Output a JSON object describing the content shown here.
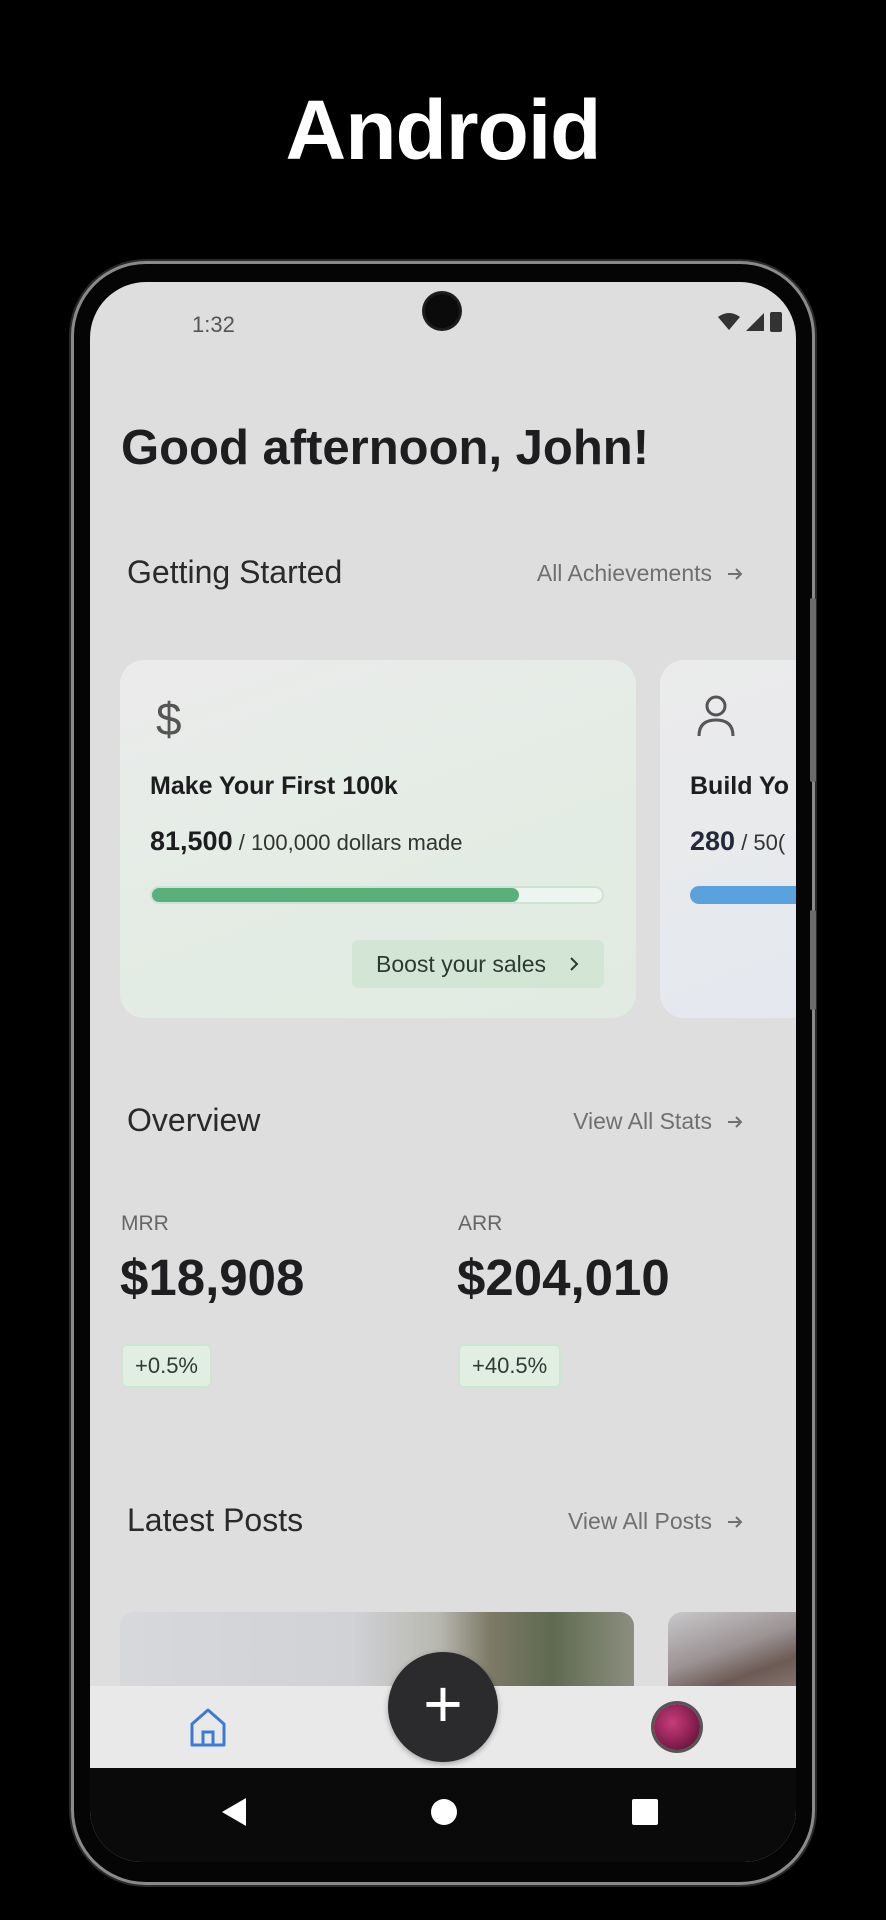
{
  "banner": {
    "title": "Android"
  },
  "status_bar": {
    "time": "1:32"
  },
  "home": {
    "greeting": "Good afternoon, John!"
  },
  "getting_started": {
    "title": "Getting Started",
    "link": "All Achievements",
    "cards": [
      {
        "icon": "dollar-icon",
        "icon_glyph": "$",
        "title": "Make Your First 100k",
        "current": "81,500",
        "suffix": "/ 100,000 dollars made",
        "progress": 0.815,
        "bar_color": "#5ab07a",
        "action": "Boost your sales"
      },
      {
        "icon": "user-icon",
        "title": "Build Yo",
        "current": "280",
        "suffix": "/ 50(",
        "bar_color": "#5aa2de"
      }
    ]
  },
  "overview": {
    "title": "Overview",
    "link": "View All Stats",
    "stats": [
      {
        "label": "MRR",
        "value": "$18,908",
        "change": "+0.5%"
      },
      {
        "label": "ARR",
        "value": "$204,010",
        "change": "+40.5%"
      }
    ]
  },
  "latest_posts": {
    "title": "Latest Posts",
    "link": "View All Posts"
  },
  "nav": {
    "items": [
      "home-icon",
      "add-icon",
      "avatar"
    ],
    "fab_glyph": "+"
  },
  "colors": {
    "accent_green": "#5ab07a",
    "accent_blue": "#5aa2de",
    "home_icon": "#3b7bd6"
  }
}
